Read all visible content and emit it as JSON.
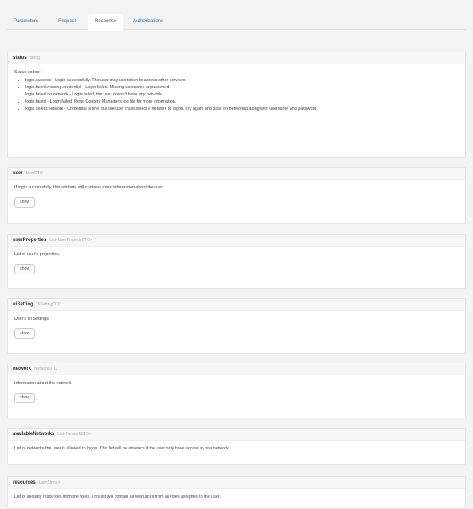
{
  "tabs": [
    "Parameters",
    "Request",
    "Response",
    "Authorizations"
  ],
  "active_tab": "Response",
  "status": {
    "name": "status",
    "type": "string",
    "intro": "Status codes:",
    "items": [
      "login.success - Login successfully. The user may use token to access other services.",
      "login.failed.missing.credential - Login failed. Missing username or password.",
      "login.failed.no.network - Login failed, the user doesn't have any network.",
      "login.failed - Login failed. Read Content Manager's log file for more information.",
      "login.select.network - Credential is fine, but the user must select a network to logon. Try again and pass on networkId along with username and password."
    ]
  },
  "sections": [
    {
      "name": "user",
      "type": "UserDTO",
      "desc": "If login successfully, this attribute will contains more information about the user.",
      "button": "show"
    },
    {
      "name": "userProperties",
      "type": "List<UserPropertyDTO>",
      "desc": "List of user's properties.",
      "button": "show"
    },
    {
      "name": "uiSetting",
      "type": "UISettingDTO",
      "desc": "User's UI Settings.",
      "button": "show"
    },
    {
      "name": "network",
      "type": "NetworkDTO",
      "desc": "Information about the network.",
      "button": "show"
    },
    {
      "name": "availableNetworks",
      "type": "List<NetworkDTO>",
      "desc": "List of networks the user is allowed to logon. This list will be absence if the user only have access to one network."
    },
    {
      "name": "resources",
      "type": "List<String>",
      "desc": "List of security resources from the roles. This list will contain all resources from all roles assigned to the user."
    }
  ]
}
